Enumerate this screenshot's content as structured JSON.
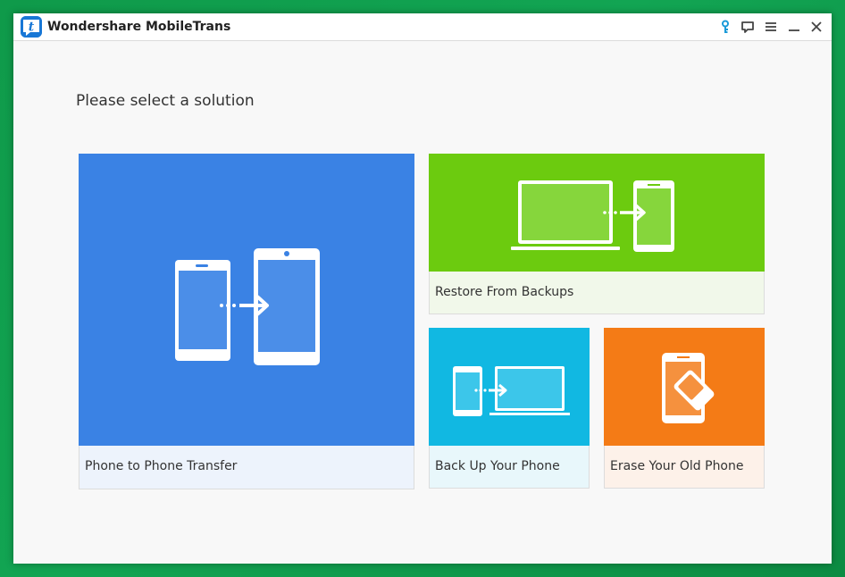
{
  "window": {
    "title": "Wondershare MobileTrans",
    "logo_letter": "t"
  },
  "toolbar": {
    "icons": [
      "key-icon",
      "feedback-icon",
      "menu-icon",
      "minimize-icon",
      "close-icon"
    ]
  },
  "main": {
    "heading": "Please select a solution"
  },
  "tiles": [
    {
      "id": "phone-to-phone",
      "label": "Phone to Phone Transfer",
      "color": "#3a82e4",
      "label_bg": "#edf3fc"
    },
    {
      "id": "restore",
      "label": "Restore From Backups",
      "color": "#6ccb0f",
      "label_bg": "#f1f8ea"
    },
    {
      "id": "backup",
      "label": "Back Up Your Phone",
      "color": "#11b8e2",
      "label_bg": "#e8f7fb"
    },
    {
      "id": "erase",
      "label": "Erase Your Old Phone",
      "color": "#f47b16",
      "label_bg": "#fdf1e9"
    }
  ],
  "colors": {
    "desktop_bg": "#12a553",
    "window_bg": "#f8f8f8",
    "accent_key": "#1a9ad8"
  }
}
